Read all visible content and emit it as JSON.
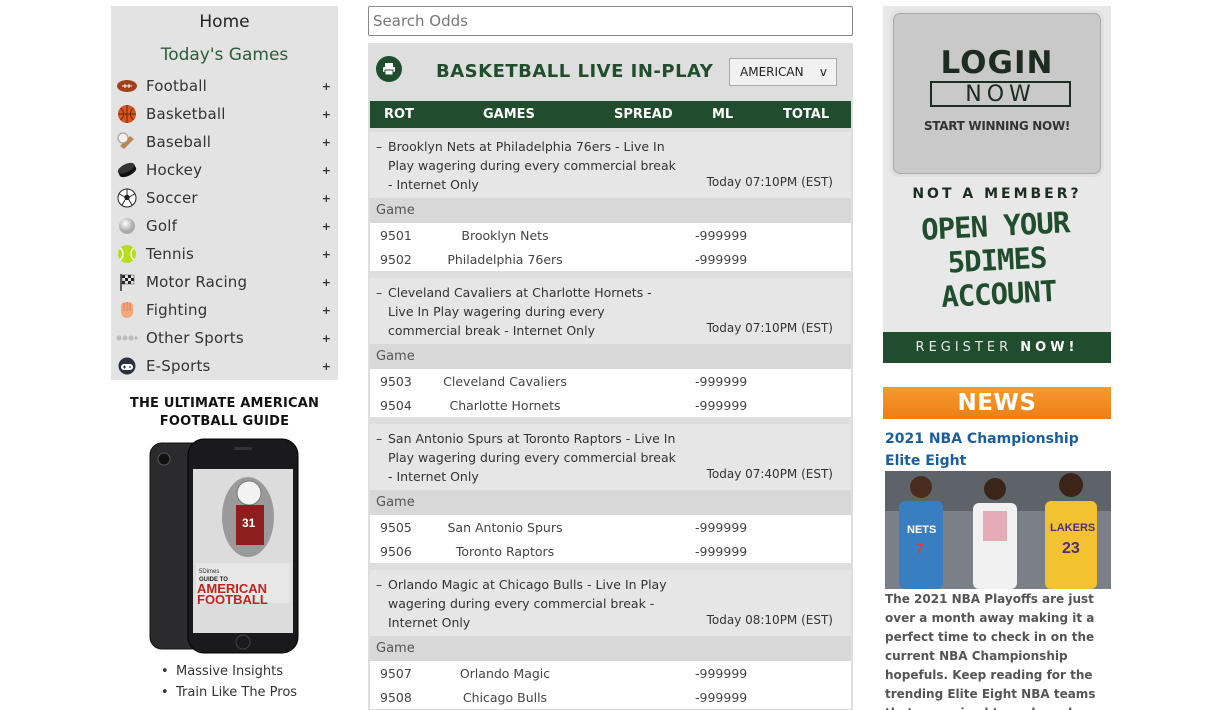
{
  "sidebar": {
    "home": "Home",
    "todays_games": "Today's Games",
    "sports": [
      {
        "label": "Football",
        "icon": "football-icon",
        "toggle": "+"
      },
      {
        "label": "Basketball",
        "icon": "basketball-icon",
        "toggle": "+"
      },
      {
        "label": "Baseball",
        "icon": "baseball-icon",
        "toggle": "+"
      },
      {
        "label": "Hockey",
        "icon": "hockey-puck-icon",
        "toggle": "+"
      },
      {
        "label": "Soccer",
        "icon": "soccer-ball-icon",
        "toggle": "+"
      },
      {
        "label": "Golf",
        "icon": "golf-ball-icon",
        "toggle": "+"
      },
      {
        "label": "Tennis",
        "icon": "tennis-ball-icon",
        "toggle": "+"
      },
      {
        "label": "Motor Racing",
        "icon": "checkered-flag-icon",
        "toggle": "+"
      },
      {
        "label": "Fighting",
        "icon": "boxing-glove-icon",
        "toggle": "+"
      },
      {
        "label": "Other Sports",
        "icon": "other-sports-icon",
        "toggle": "+"
      },
      {
        "label": "E-Sports",
        "icon": "gamepad-icon",
        "toggle": "+"
      }
    ]
  },
  "guide": {
    "title_line1": "THE ULTIMATE AMERICAN",
    "title_line2": "FOOTBALL GUIDE",
    "bullets": [
      "Massive Insights",
      "Train Like The Pros"
    ]
  },
  "search": {
    "placeholder": "Search Odds"
  },
  "main": {
    "title": "BASKETBALL LIVE IN-PLAY",
    "odds_format": "AMERICAN",
    "odds_chevron": "v",
    "columns": [
      "ROT",
      "GAMES",
      "SPREAD",
      "ML",
      "TOTAL"
    ],
    "game_label": "Game",
    "games": [
      {
        "description": "Brooklyn Nets at Philadelphia 76ers - Live In Play wagering during every commercial break - Internet Only",
        "time": "Today 07:10PM (EST)",
        "teams": [
          {
            "rot": "9501",
            "name": "Brooklyn Nets",
            "ml": "-999999"
          },
          {
            "rot": "9502",
            "name": "Philadelphia 76ers",
            "ml": "-999999"
          }
        ]
      },
      {
        "description": "Cleveland Cavaliers at Charlotte Hornets - Live In Play wagering during every commercial break - Internet Only",
        "time": "Today 07:10PM (EST)",
        "teams": [
          {
            "rot": "9503",
            "name": "Cleveland Cavaliers",
            "ml": "-999999"
          },
          {
            "rot": "9504",
            "name": "Charlotte Hornets",
            "ml": "-999999"
          }
        ]
      },
      {
        "description": "San Antonio Spurs at Toronto Raptors - Live In Play wagering during every commercial break - Internet Only",
        "time": "Today 07:40PM (EST)",
        "teams": [
          {
            "rot": "9505",
            "name": "San Antonio Spurs",
            "ml": "-999999"
          },
          {
            "rot": "9506",
            "name": "Toronto Raptors",
            "ml": "-999999"
          }
        ]
      },
      {
        "description": "Orlando Magic at Chicago Bulls - Live In Play wagering during every commercial break - Internet Only",
        "time": "Today 08:10PM (EST)",
        "teams": [
          {
            "rot": "9507",
            "name": "Orlando Magic",
            "ml": "-999999"
          },
          {
            "rot": "9508",
            "name": "Chicago Bulls",
            "ml": "-999999"
          }
        ]
      }
    ]
  },
  "ad": {
    "login": "LOGIN",
    "now": "NOW",
    "start": "START WINNING NOW!",
    "not_member": "NOT A MEMBER?",
    "open_line1": "OPEN YOUR",
    "open_line2": "5DIMES",
    "open_line3": "ACCOUNT",
    "register_a": "REGISTER",
    "register_b": "NOW!"
  },
  "news": {
    "header": "NEWS",
    "title": "2021 NBA Championship Elite Eight",
    "body": "The 2021 NBA Playoffs are just over a month away making it a perfect time to check in on the current NBA Championship hopefuls. Keep reading for the trending Elite Eight NBA teams that are poised to make a deep playoff run."
  },
  "colors": {
    "brand_green": "#1f4d2e",
    "news_orange": "#f28a22",
    "link_blue": "#1b5e9f"
  }
}
